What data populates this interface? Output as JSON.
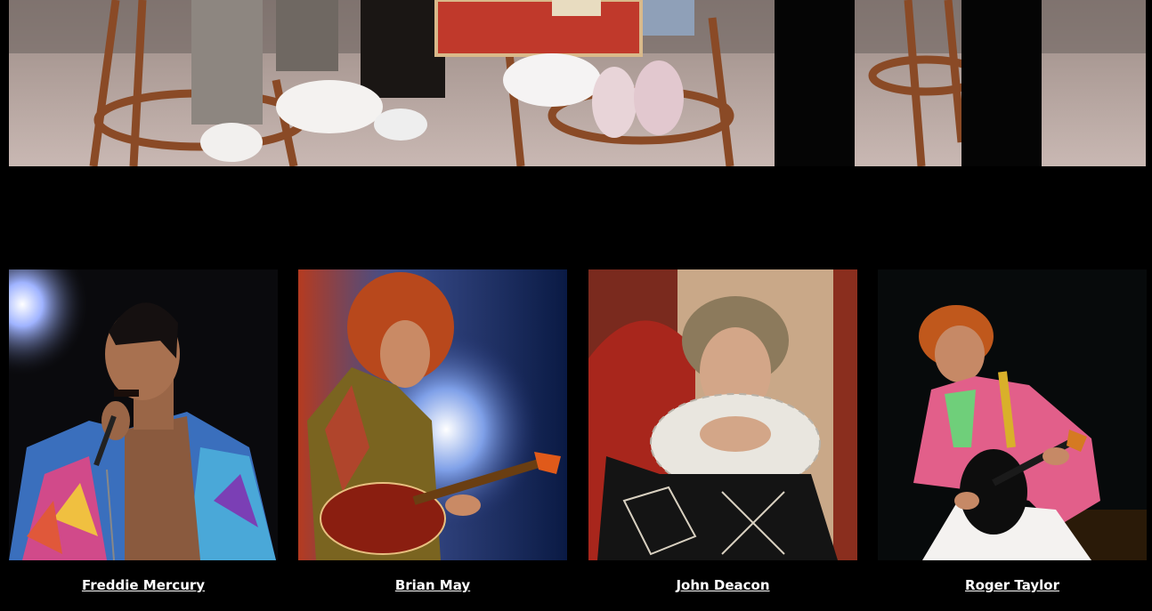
{
  "hero": {
    "image_semantic": "band-members-seated-on-stools-photo"
  },
  "members": [
    {
      "name": "Freddie Mercury",
      "image_semantic": "freddie-mercury-photo"
    },
    {
      "name": "Brian May",
      "image_semantic": "brian-may-photo"
    },
    {
      "name": "John Deacon",
      "image_semantic": "john-deacon-photo"
    },
    {
      "name": "Roger Taylor",
      "image_semantic": "roger-taylor-photo"
    }
  ],
  "colors": {
    "background": "#000000",
    "link": "#ffffff"
  }
}
